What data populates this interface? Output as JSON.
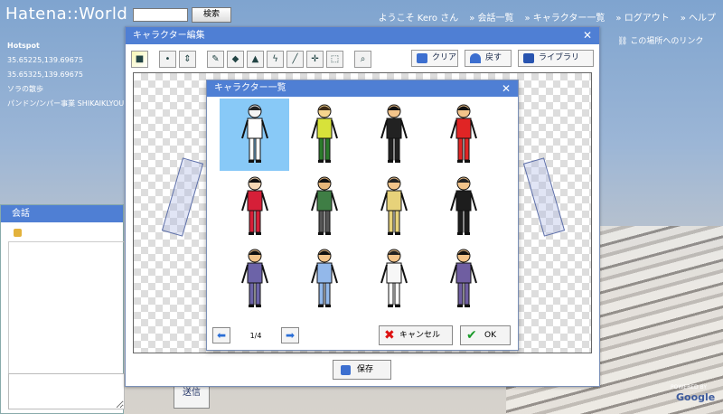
{
  "app": {
    "logo": "Hatena::World",
    "search_button": "検索",
    "search_value": ""
  },
  "nav": [
    "ようこそ Kero さん",
    "会話一覧",
    "キャラクター一覧",
    "ログアウト",
    "ヘルプ"
  ],
  "link_here": "この場所へのリンク",
  "hotspot": {
    "title": "Hotspot",
    "items": [
      "35.65225,139.69675",
      "35.65325,139.69675",
      "ソラの散歩",
      "パンドン/ンパー事業 SHIKAIKLYOU"
    ]
  },
  "chat": {
    "title": "会話",
    "send_label": "送信"
  },
  "editor": {
    "title": "キャラクター編集",
    "clear_label": "クリア",
    "undo_label": "戻す",
    "library_label": "ライブラリ",
    "save_label": "保存"
  },
  "character_list": {
    "title": "キャラクター一覧",
    "page": "1/4",
    "cancel_label": "キャンセル",
    "ok_label": "OK",
    "characters": [
      {
        "name": "skeleton",
        "skin": "#f4f4f4",
        "shirt": "#ffffff",
        "pants": "#ffffff",
        "hair": "#222"
      },
      {
        "name": "yellow-shirt",
        "skin": "#f6d48e",
        "shirt": "#d7e23a",
        "pants": "#2b7a2b",
        "hair": "#3e2b16"
      },
      {
        "name": "black-suit",
        "skin": "#f3c48a",
        "shirt": "#222",
        "pants": "#222",
        "hair": "#111"
      },
      {
        "name": "red-dress",
        "skin": "#f3c48a",
        "shirt": "#e02525",
        "pants": "#e02525",
        "hair": "#111"
      },
      {
        "name": "kimono",
        "skin": "#f7d9b5",
        "shirt": "#d61f38",
        "pants": "#d61f38",
        "hair": "#111"
      },
      {
        "name": "striped-shirt",
        "skin": "#e8b77a",
        "shirt": "#3f7e45",
        "pants": "#555",
        "hair": "#111"
      },
      {
        "name": "yellow-suit",
        "skin": "#f3c48a",
        "shirt": "#e7d27a",
        "pants": "#e7d27a",
        "hair": "#222"
      },
      {
        "name": "black-dress",
        "skin": "#f3c48a",
        "shirt": "#1d1d1d",
        "pants": "#1d1d1d",
        "hair": "#222"
      },
      {
        "name": "purple-outfit",
        "skin": "#f3c48a",
        "shirt": "#6c63a8",
        "pants": "#6c63a8",
        "hair": "#111"
      },
      {
        "name": "blue-shirt",
        "skin": "#f3c48a",
        "shirt": "#93b8ea",
        "pants": "#93b8ea",
        "hair": "#111"
      },
      {
        "name": "white-shirt",
        "skin": "#f3c48a",
        "shirt": "#f7f7f7",
        "pants": "#ffffff",
        "hair": "#222"
      },
      {
        "name": "purple-jacket",
        "skin": "#f3c48a",
        "shirt": "#6f5ea1",
        "pants": "#6f5ea1",
        "hair": "#111"
      }
    ]
  },
  "colors": {
    "header_bar": "#4f7fd4",
    "selection": "#88c9f7"
  },
  "map_attribution": "Google"
}
